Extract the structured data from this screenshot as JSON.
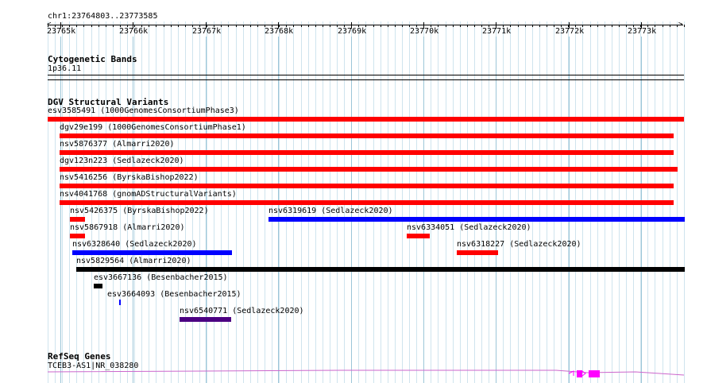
{
  "ruler": {
    "location": "chr1:23764803..23773585",
    "ticks": [
      "23765k",
      "23766k",
      "23767k",
      "23768k",
      "23769k",
      "23770k",
      "23771k",
      "23772k",
      "23773k"
    ]
  },
  "cytoband": {
    "title": "Cytogenetic Bands",
    "band": "1p36.11"
  },
  "dgv": {
    "title": "DGV Structural Variants",
    "colors": {
      "red": "#ff0000",
      "blue": "#0000ff",
      "black": "#000000",
      "purple": "#4b0082"
    },
    "variants": [
      {
        "label": "esv3585491 (1000GenomesConsortiumPhase3)",
        "color": "red"
      },
      {
        "label": "dgv29e199 (1000GenomesConsortiumPhase1)",
        "color": "red"
      },
      {
        "label": "nsv5876377 (Almarri2020)",
        "color": "red"
      },
      {
        "label": "dgv123n223 (Sedlazeck2020)",
        "color": "red"
      },
      {
        "label": "nsv5416256 (ByrskaBishop2022)",
        "color": "red"
      },
      {
        "label": "nsv4041768 (gnomADStructuralVariants)",
        "color": "red"
      },
      {
        "label": "nsv5426375 (ByrskaBishop2022)",
        "color": "red"
      },
      {
        "label": "nsv6319619 (Sedlazeck2020)",
        "color": "blue"
      },
      {
        "label": "nsv5867918 (Almarri2020)",
        "color": "red"
      },
      {
        "label": "nsv6334051 (Sedlazeck2020)",
        "color": "red"
      },
      {
        "label": "nsv6328640 (Sedlazeck2020)",
        "color": "blue"
      },
      {
        "label": "nsv6318227 (Sedlazeck2020)",
        "color": "red"
      },
      {
        "label": "nsv5829564 (Almarri2020)",
        "color": "black"
      },
      {
        "label": "esv3667136 (Besenbacher2015)",
        "color": "black"
      },
      {
        "label": "esv3664093 (Besenbacher2015)",
        "color": "blue"
      },
      {
        "label": "nsv6540771 (Sedlazeck2020)",
        "color": "purple"
      }
    ]
  },
  "refseq": {
    "title": "RefSeq Genes",
    "gene_label": "TCEB3-AS1|NR_038280",
    "color": "#ff00ff"
  }
}
